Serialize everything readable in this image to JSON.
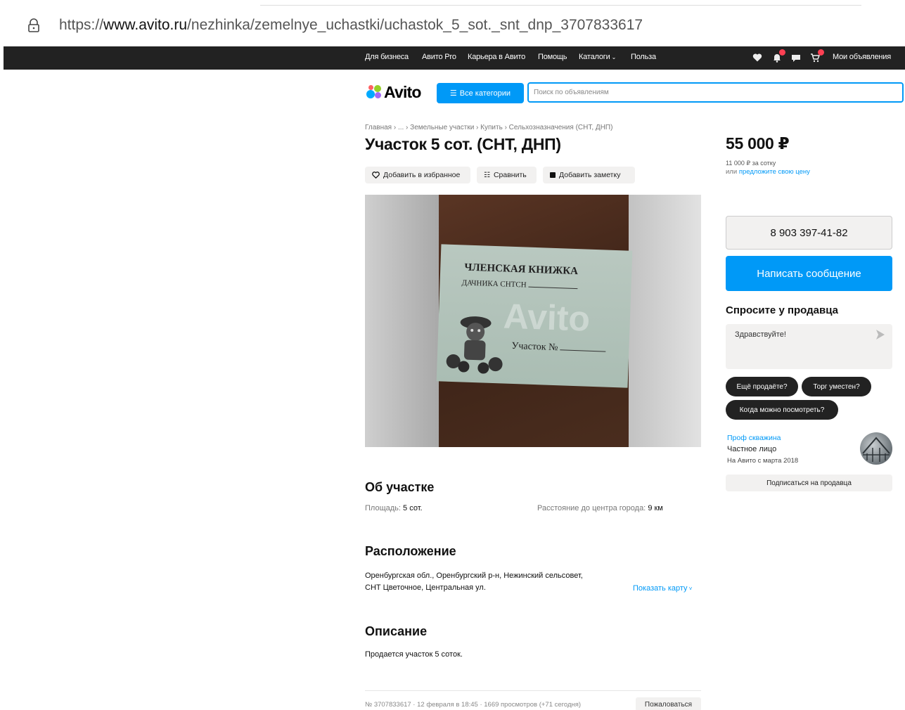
{
  "browser": {
    "url_prefix": "https://",
    "url_domain": "www.avito.ru",
    "url_path": "/nezhinka/zemelnye_uchastki/uchastok_5_sot._snt_dnp_3707833617"
  },
  "topnav": {
    "links": [
      "Для бизнеса",
      "Авито Pro",
      "Карьера в Авито",
      "Помощь",
      "Каталоги",
      "Польза"
    ],
    "my_ads": "Мои объявления"
  },
  "header": {
    "logo": "Avito",
    "categories_button": "Все категории",
    "search_placeholder": "Поиск по объявлениям"
  },
  "breadcrumb": "Главная › ... › Земельные участки › Купить › Сельхозназначения (СНТ, ДНП)",
  "listing": {
    "title": "Участок 5 сот. (СНТ, ДНП)",
    "actions": {
      "favorite": "Добавить в избранное",
      "compare": "Сравнить",
      "note": "Добавить заметку"
    },
    "photo_text": {
      "line1": "ЧЛЕНСКАЯ КНИЖКА",
      "line2": "ДАЧНИКА СНТСН",
      "line3": "Участок №",
      "watermark": "Avito"
    }
  },
  "about": {
    "title": "Об участке",
    "area_label": "Площадь:",
    "area_value": "5 сот.",
    "distance_label": "Расстояние до центра города:",
    "distance_value": "9 км"
  },
  "location": {
    "title": "Расположение",
    "address_line1": "Оренбургская обл., Оренбургский р-н, Нежинский сельсовет,",
    "address_line2": "СНТ Цветочное, Центральная ул.",
    "map_link": "Показать карту"
  },
  "description": {
    "title": "Описание",
    "text": "Продается участок 5 соток."
  },
  "footer_meta": {
    "info": "№ 3707833617 · 12 февраля в 18:45 · 1669 просмотров (+71 сегодня)",
    "report": "Пожаловаться"
  },
  "sidebar": {
    "price": "55 000 ₽",
    "price_per_sotka": "11 000 ₽ за сотку",
    "offer_prefix": "или",
    "offer_link": "предложите свою цену",
    "phone": "8 903 397-41-82",
    "message_button": "Написать сообщение",
    "ask_title": "Спросите у продавца",
    "ask_placeholder": "Здравствуйте!",
    "quick_questions": [
      "Ещё продаёте?",
      "Торг уместен?",
      "Когда можно посмотреть?"
    ],
    "seller_name": "Проф скважина",
    "seller_type": "Частное лицо",
    "seller_since": "На Авито с марта 2018",
    "subscribe": "Подписаться на продавца"
  },
  "colors": {
    "accent": "#0099f7",
    "nav_bg": "#222222",
    "badge": "#ff4053"
  }
}
